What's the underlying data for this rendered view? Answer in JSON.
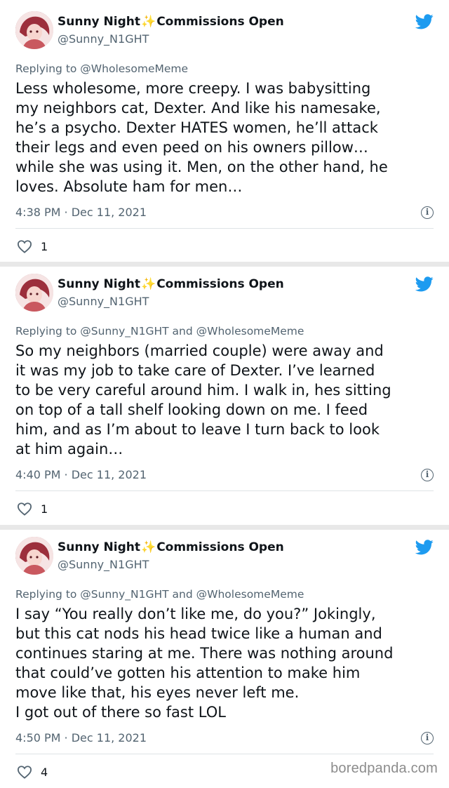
{
  "tweets": [
    {
      "display_name": "Sunny Night",
      "name_suffix": "Commissions Open",
      "sparkle": "✨",
      "handle": "@Sunny_N1GHT",
      "replying": "Replying to @WholesomeMeme",
      "text": "Less wholesome, more creepy. I was babysitting\nmy neighbors cat, Dexter. And like his namesake,\nhe’s a psycho. Dexter HATES women, he’ll attack\ntheir legs and even peed on his owners pillow…\nwhile she was using it. Men, on the other hand, he\nloves. Absolute ham for men…",
      "timestamp": "4:38 PM · Dec 11, 2021",
      "likes": "1"
    },
    {
      "display_name": "Sunny Night",
      "name_suffix": "Commissions Open",
      "sparkle": "✨",
      "handle": "@Sunny_N1GHT",
      "replying": "Replying to @Sunny_N1GHT and @WholesomeMeme",
      "text": "So my neighbors (married couple) were away and\nit was my job to take care of Dexter. I’ve learned\nto be very careful around him. I walk in, hes sitting\non top of a tall shelf looking down on me. I feed\nhim, and as I’m about to leave I turn back to look\nat him again…",
      "timestamp": "4:40 PM · Dec 11, 2021",
      "likes": "1"
    },
    {
      "display_name": "Sunny Night",
      "name_suffix": "Commissions Open",
      "sparkle": "✨",
      "handle": "@Sunny_N1GHT",
      "replying": "Replying to @Sunny_N1GHT and @WholesomeMeme",
      "text": "I say “You really don’t like me, do you?” Jokingly,\nbut this cat nods his head twice like a human and\ncontinues staring at me. There was nothing around\nthat could’ve gotten his attention to make him\nmove like that, his eyes never left me.\nI got out of there so fast LOL",
      "timestamp": "4:50 PM · Dec 11, 2021",
      "likes": "4"
    }
  ],
  "watermark": "boredpanda.com",
  "colors": {
    "twitter_blue": "#1d9bf0",
    "secondary_text": "#536471",
    "sparkle": "#f3b23b"
  },
  "icons": {
    "brand": "twitter-bird-icon",
    "info": "info-icon",
    "like": "heart-icon"
  }
}
